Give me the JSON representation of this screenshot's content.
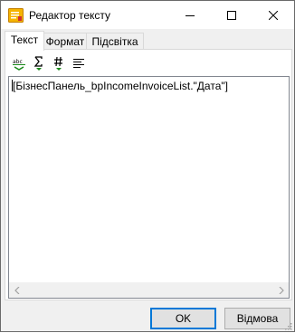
{
  "window": {
    "title": "Редактор тексту",
    "controls": {
      "minimize": "minimize",
      "maximize": "maximize",
      "close": "close"
    }
  },
  "tabs": [
    {
      "label": "Текст",
      "active": true
    },
    {
      "label": "Формат",
      "active": false
    },
    {
      "label": "Підсвітка",
      "active": false
    }
  ],
  "toolbar": {
    "icons": [
      "abc-spellcheck-icon",
      "sigma-aggregate-icon",
      "hash-format-icon",
      "align-text-icon"
    ]
  },
  "editor": {
    "text": "[БізнесПанель_bpIncomeInvoiceList.\"Дата\"]"
  },
  "buttons": {
    "ok": "OK",
    "cancel": "Відмова"
  },
  "colors": {
    "accent": "#0078d7",
    "window_bg": "#f0f0f0",
    "editor_bg": "#ffffff",
    "toolbar_green": "#1a8a1a"
  }
}
